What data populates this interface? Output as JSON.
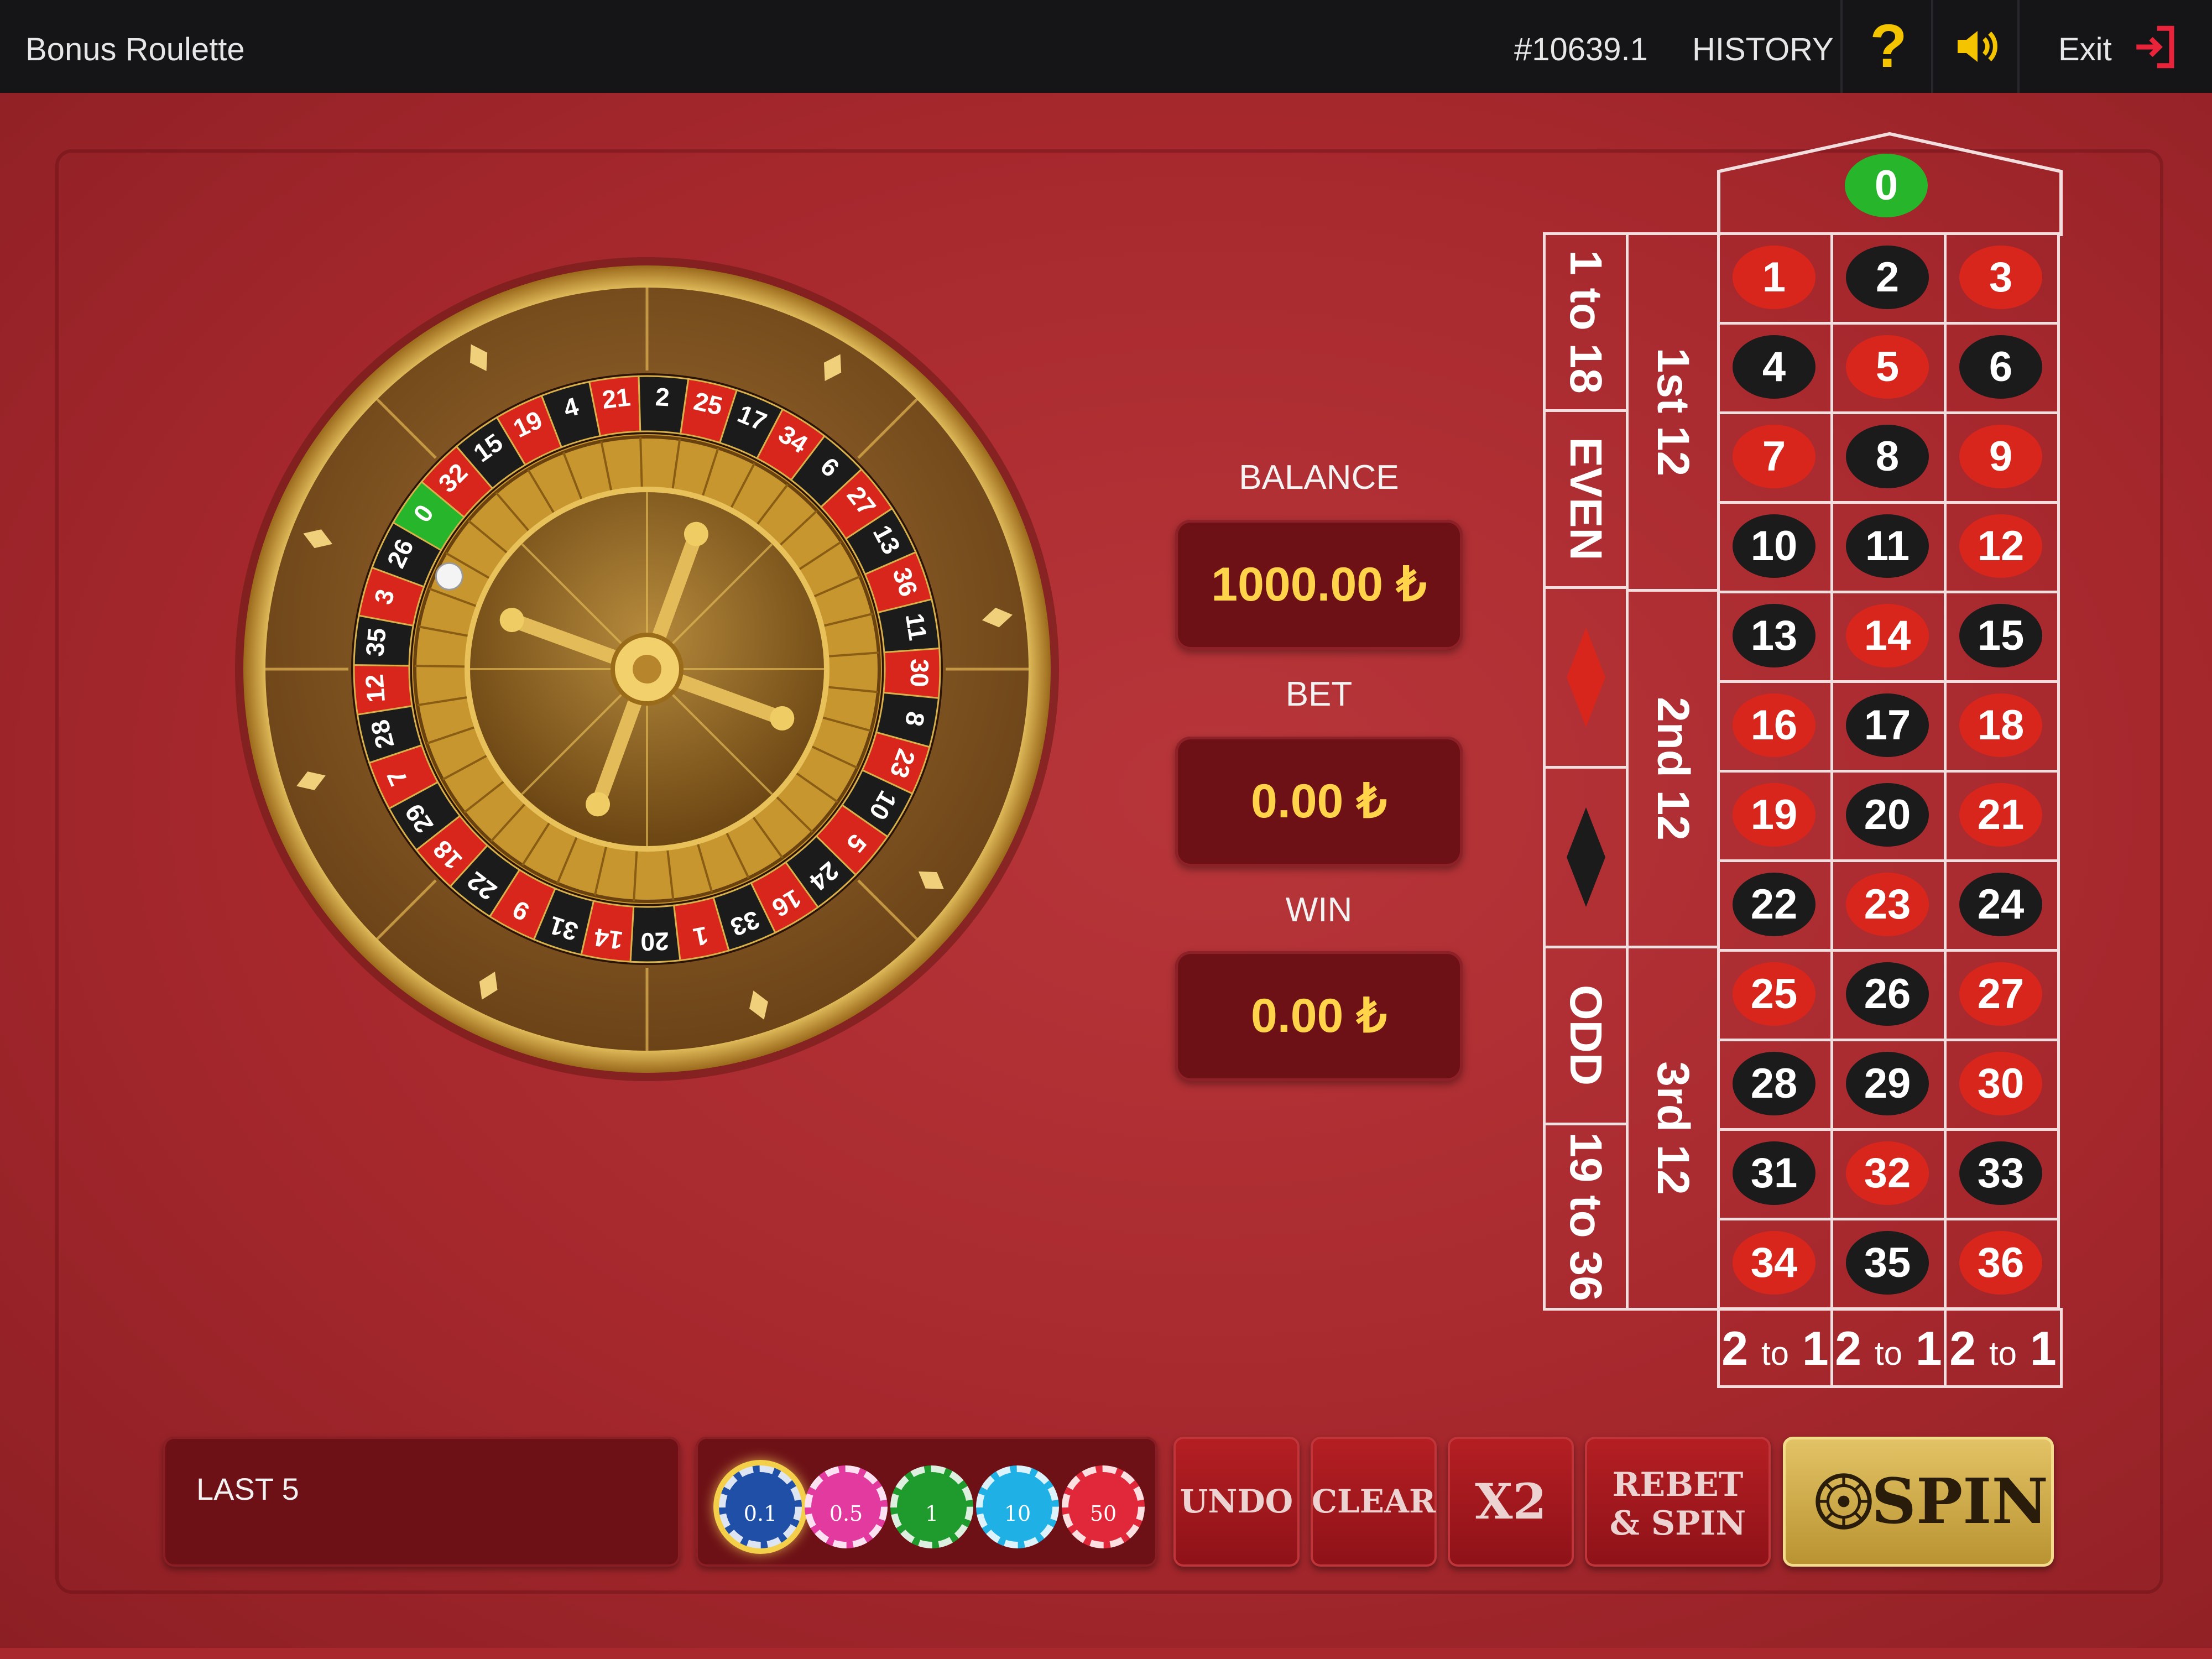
{
  "header": {
    "title": "Bonus Roulette",
    "game_id": "#10639.1",
    "history": "HISTORY",
    "help": "?",
    "exit": "Exit"
  },
  "wheel": {
    "sequence": [
      "0",
      "32",
      "15",
      "19",
      "4",
      "21",
      "2",
      "25",
      "17",
      "34",
      "6",
      "27",
      "13",
      "36",
      "11",
      "30",
      "8",
      "23",
      "10",
      "5",
      "24",
      "16",
      "33",
      "1",
      "20",
      "14",
      "31",
      "9",
      "22",
      "18",
      "29",
      "7",
      "28",
      "12",
      "35",
      "3",
      "26"
    ],
    "ball_on": "26"
  },
  "panel": {
    "balance_label": "BALANCE",
    "balance_value": "1000.00 ₺",
    "bet_label": "BET",
    "bet_value": "0.00 ₺",
    "win_label": "WIN",
    "win_value": "0.00 ₺"
  },
  "board": {
    "zero": "0",
    "rows": [
      [
        "1",
        "2",
        "3"
      ],
      [
        "4",
        "5",
        "6"
      ],
      [
        "7",
        "8",
        "9"
      ],
      [
        "10",
        "11",
        "12"
      ],
      [
        "13",
        "14",
        "15"
      ],
      [
        "16",
        "17",
        "18"
      ],
      [
        "19",
        "20",
        "21"
      ],
      [
        "22",
        "23",
        "24"
      ],
      [
        "25",
        "26",
        "27"
      ],
      [
        "28",
        "29",
        "30"
      ],
      [
        "31",
        "32",
        "33"
      ],
      [
        "34",
        "35",
        "36"
      ]
    ],
    "red_numbers": [
      "1",
      "3",
      "5",
      "7",
      "9",
      "12",
      "14",
      "16",
      "18",
      "19",
      "21",
      "23",
      "25",
      "27",
      "30",
      "32",
      "34",
      "36"
    ],
    "dozens": [
      "1st 12",
      "2nd 12",
      "3rd 12"
    ],
    "outside": {
      "low": "1 to 18",
      "even": "EVEN",
      "odd": "ODD",
      "high": "19 to 36"
    },
    "column_bet": {
      "big1": "2",
      "small": "to",
      "big2": "1"
    }
  },
  "bottom": {
    "last5_label": "LAST 5",
    "chips": [
      {
        "label": "0.1",
        "color": "#1f4fa6",
        "selected": true
      },
      {
        "label": "0.5",
        "color": "#e33aa0",
        "selected": false
      },
      {
        "label": "1",
        "color": "#1f9b2d",
        "selected": false
      },
      {
        "label": "10",
        "color": "#1fb1e6",
        "selected": false
      },
      {
        "label": "50",
        "color": "#e0283a",
        "selected": false
      }
    ],
    "undo": "UNDO",
    "clear": "CLEAR",
    "x2": "X2",
    "rebet_line1": "REBET",
    "rebet_line2": "& SPIN",
    "spin": "SPIN"
  },
  "colors": {
    "accent": "#ffd44a",
    "felt": "#a8282d",
    "topbar": "#151518",
    "red": "#d9261c",
    "black": "#1b1b1b",
    "green": "#27b52b",
    "gold": "#d8b14a"
  }
}
